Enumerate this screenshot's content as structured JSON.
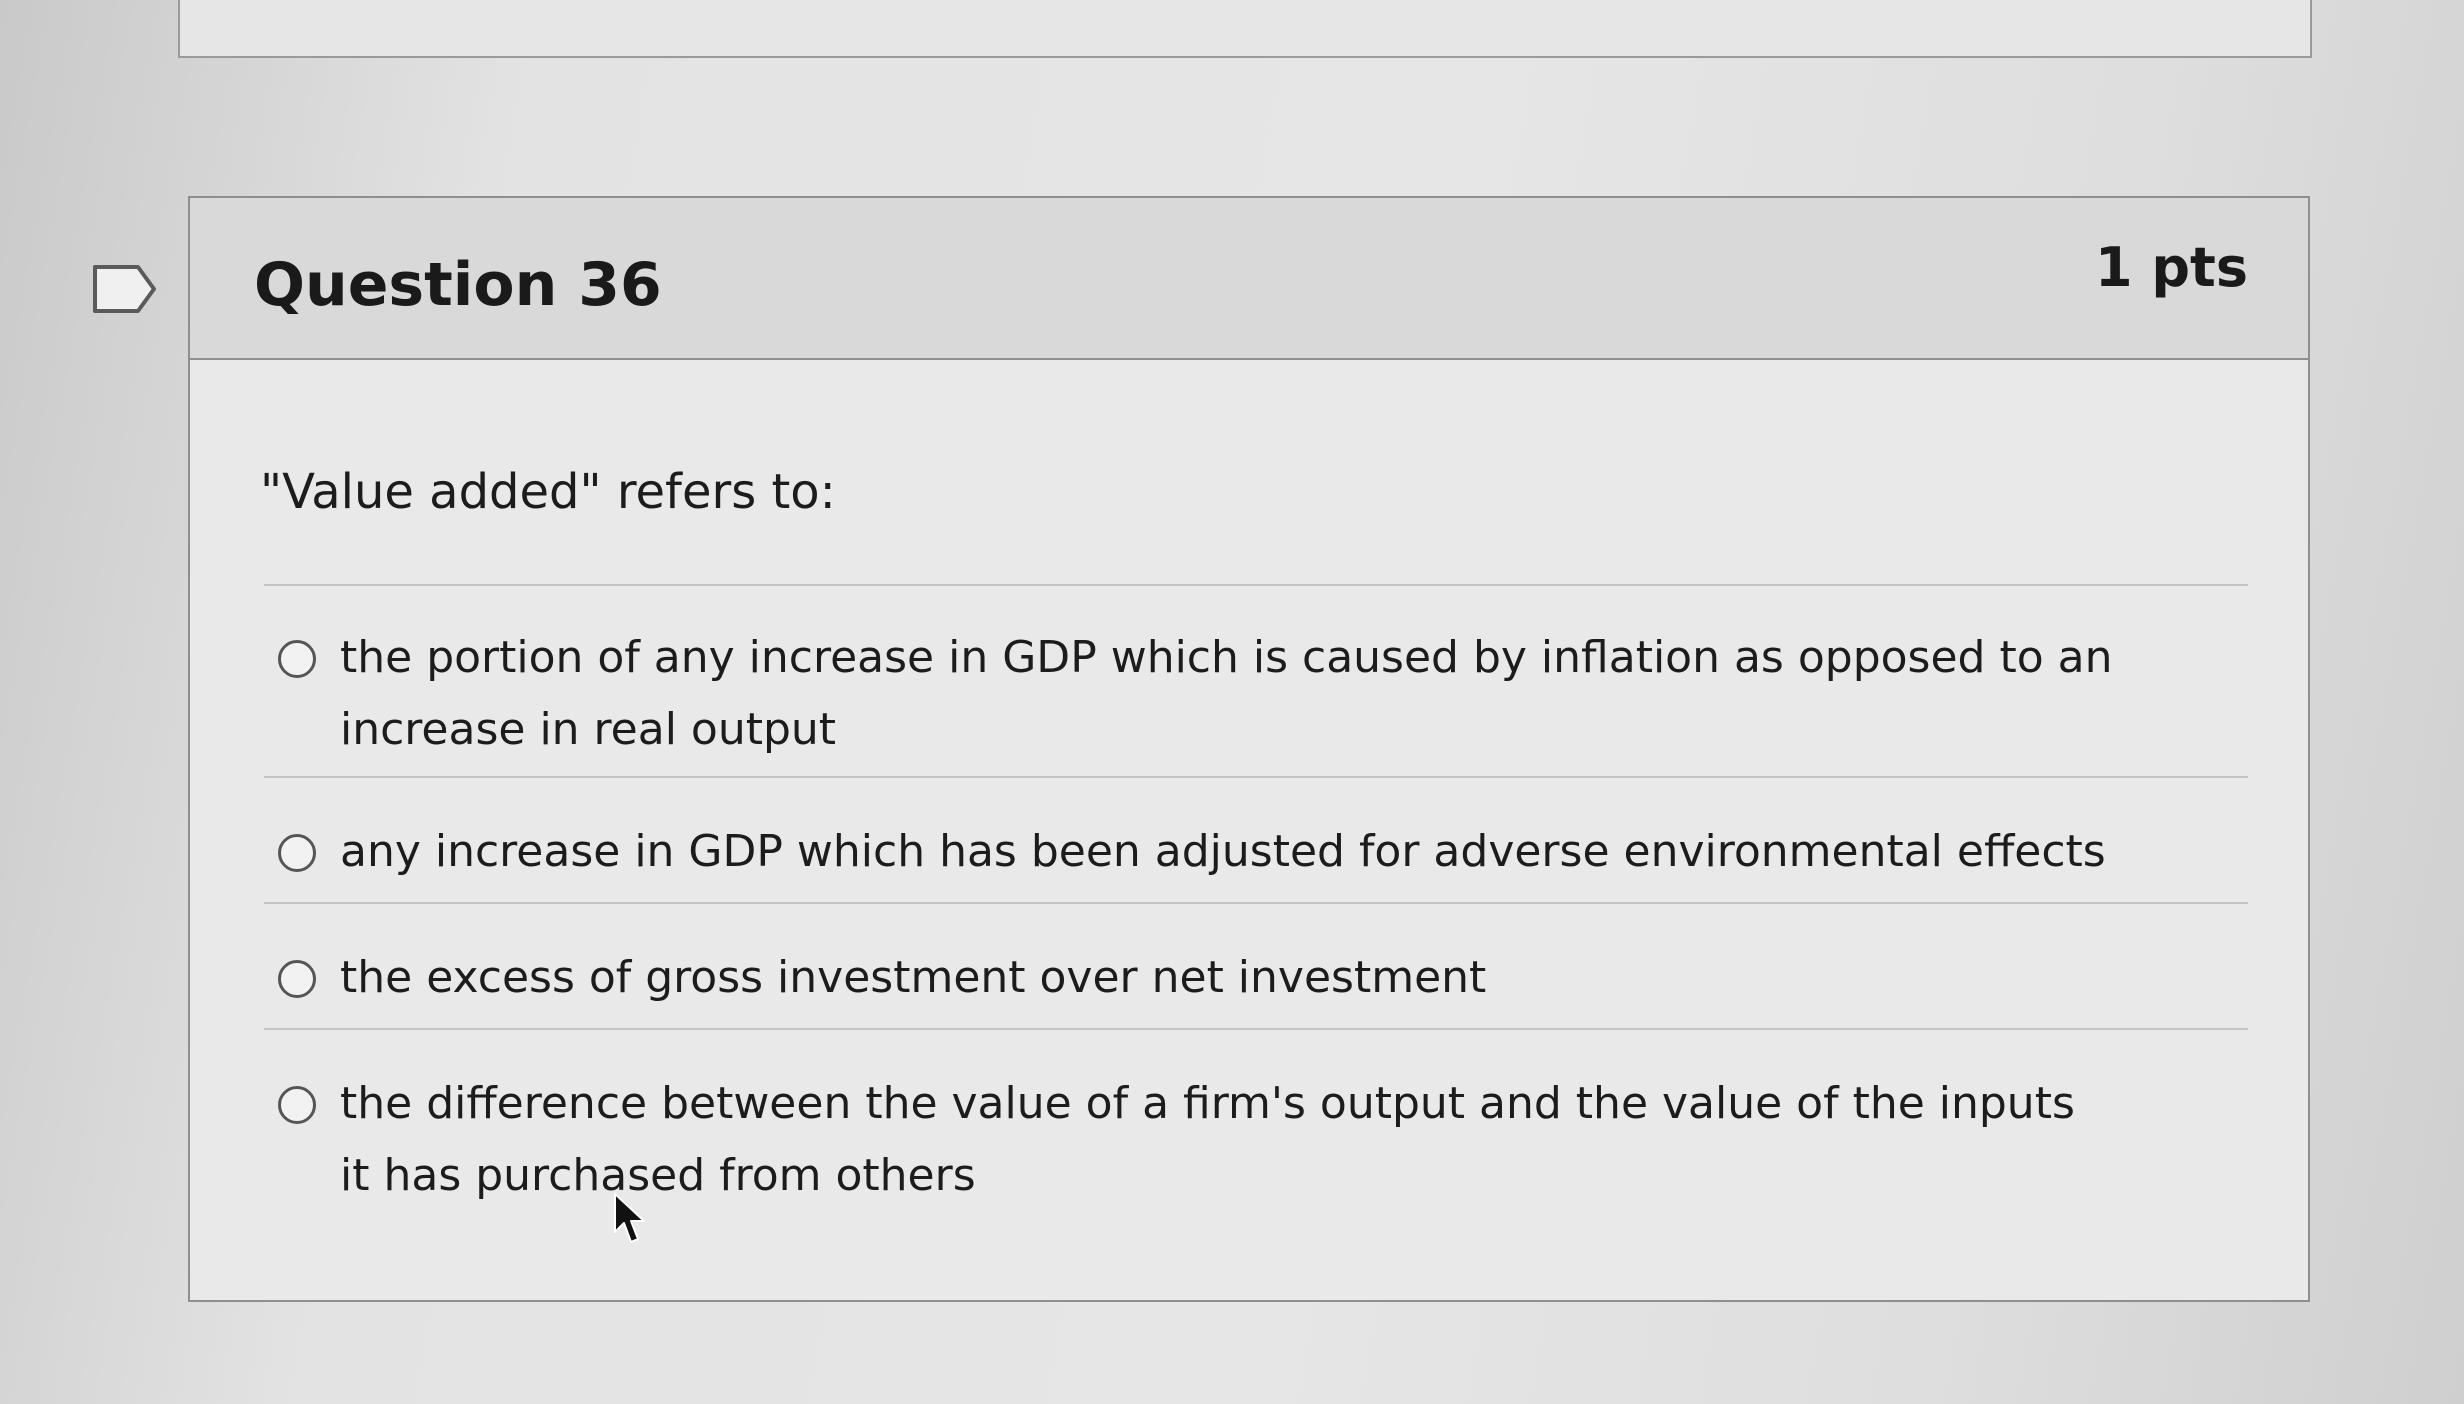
{
  "question": {
    "title": "Question 36",
    "points": "1 pts",
    "prompt": "\"Value added\" refers to:",
    "answers": [
      {
        "label": "the portion of any increase in GDP which is caused by inflation as opposed to an increase in real output",
        "selected": false
      },
      {
        "label": "any increase in GDP which has been adjusted for adverse environmental effects",
        "selected": false
      },
      {
        "label": "the excess of gross investment over net investment",
        "selected": false
      },
      {
        "label": "the difference between the value of a firm's output and the value of the inputs it has purchased from others",
        "selected": false
      }
    ]
  },
  "icons": {
    "flag": "flag-icon",
    "cursor": "mouse-pointer-icon"
  },
  "colors": {
    "background": "#e4e4e4",
    "header_background": "#d9d9d9",
    "border": "#8f8f8f",
    "text": "#1c1c1c"
  }
}
